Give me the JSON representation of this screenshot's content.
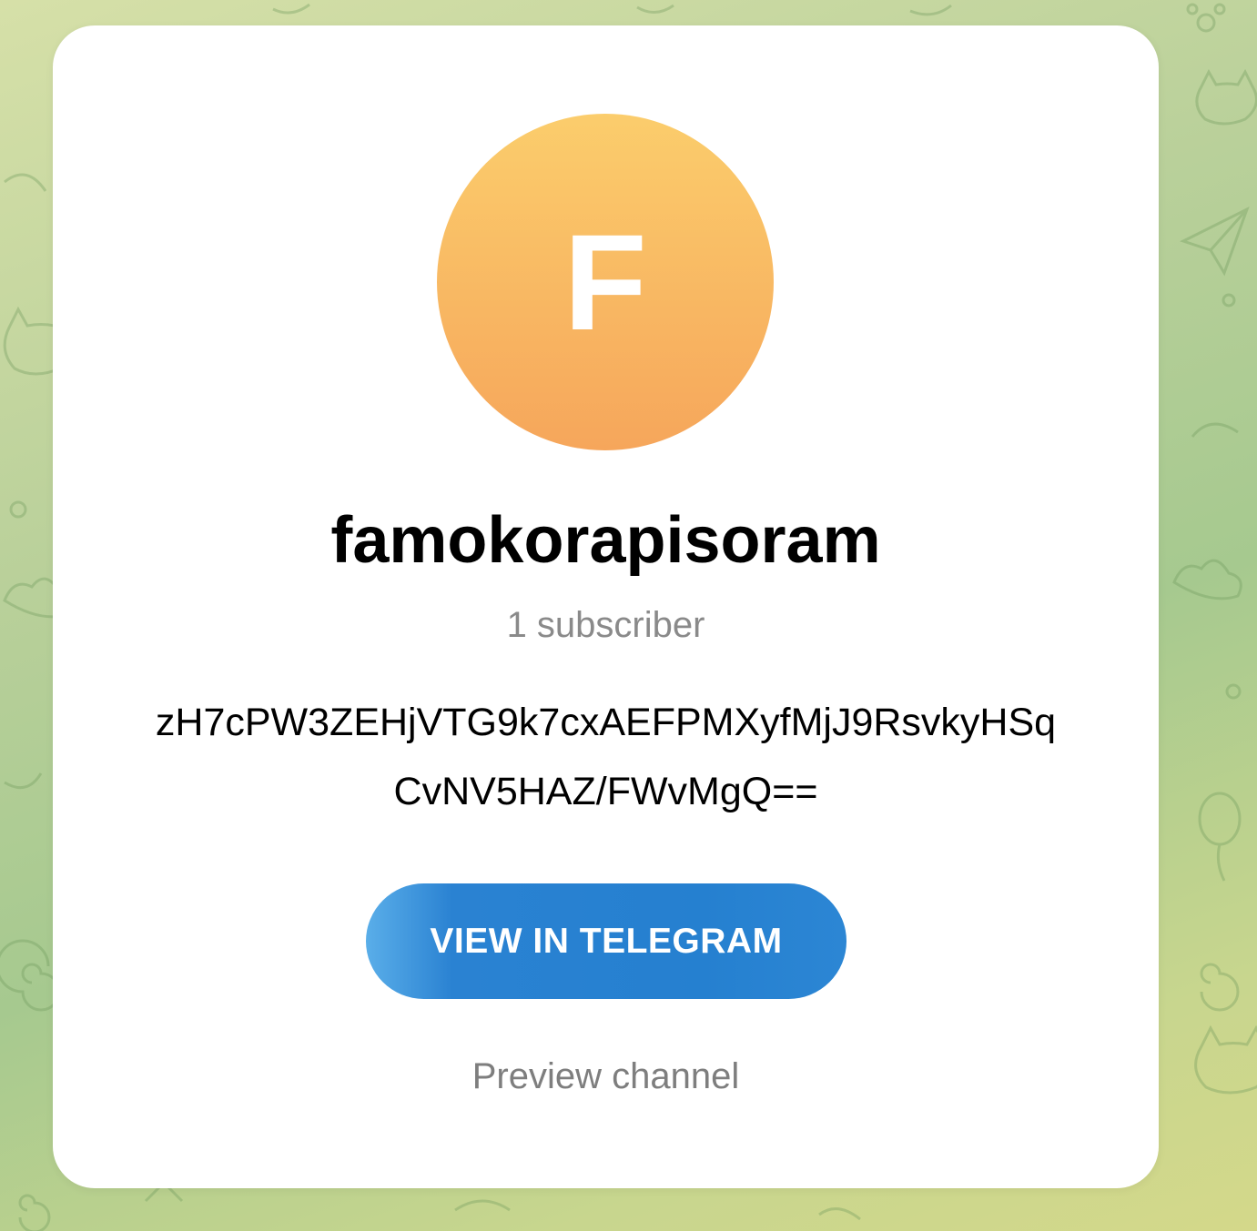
{
  "channel": {
    "avatar_letter": "F",
    "name": "famokorapisoram",
    "subscribers": "1 subscriber",
    "description_lines": [
      "zH7cPW3ZEHjVTG9k7cxAEFPMXyfMjJ9RsvkyHSq",
      "CvNV5HAZ/FWvMgQ=="
    ]
  },
  "actions": {
    "view_button_label": "VIEW IN TELEGRAM",
    "preview_link_label": "Preview channel"
  },
  "colors": {
    "avatar_gradient_top": "#fbcd6c",
    "avatar_gradient_bottom": "#f6a65b",
    "button_blue": "#2580d0",
    "muted_text": "#8a8a8a"
  },
  "icons": {
    "background_doodles": [
      "paper-plane-icon",
      "cat-icon",
      "spiral-icon",
      "cloud-icon",
      "balloon-icon",
      "paw-icon"
    ]
  }
}
